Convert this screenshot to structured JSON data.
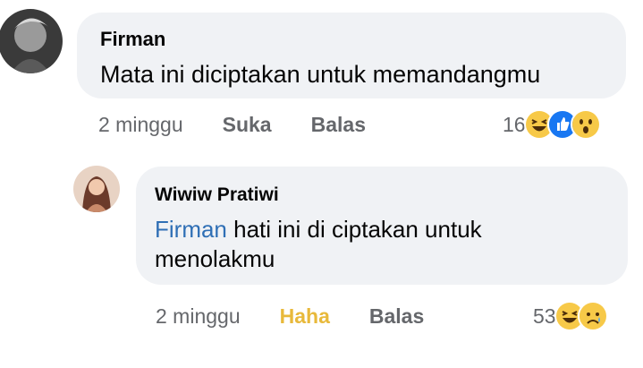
{
  "comment": {
    "author": "Firman",
    "text": "Mata ini diciptakan untuk memandangmu",
    "time": "2 minggu",
    "like_label": "Suka",
    "reply_label": "Balas",
    "reaction_count": "16",
    "reactions": [
      "haha-icon",
      "like-icon",
      "wow-icon"
    ]
  },
  "reply": {
    "author": "Wiwiw Pratiwi",
    "mention": "Firman",
    "text": "hati ini di ciptakan untuk menolakmu",
    "time": "2 minggu",
    "reaction_label": "Haha",
    "reply_label": "Balas",
    "reaction_count": "53",
    "reactions": [
      "haha-icon",
      "sad-icon"
    ]
  },
  "colors": {
    "bubble": "#f0f2f5",
    "mention": "#2f6fb5",
    "haha": "#e8b93b",
    "like": "#1877f2",
    "meta": "#65676b"
  }
}
